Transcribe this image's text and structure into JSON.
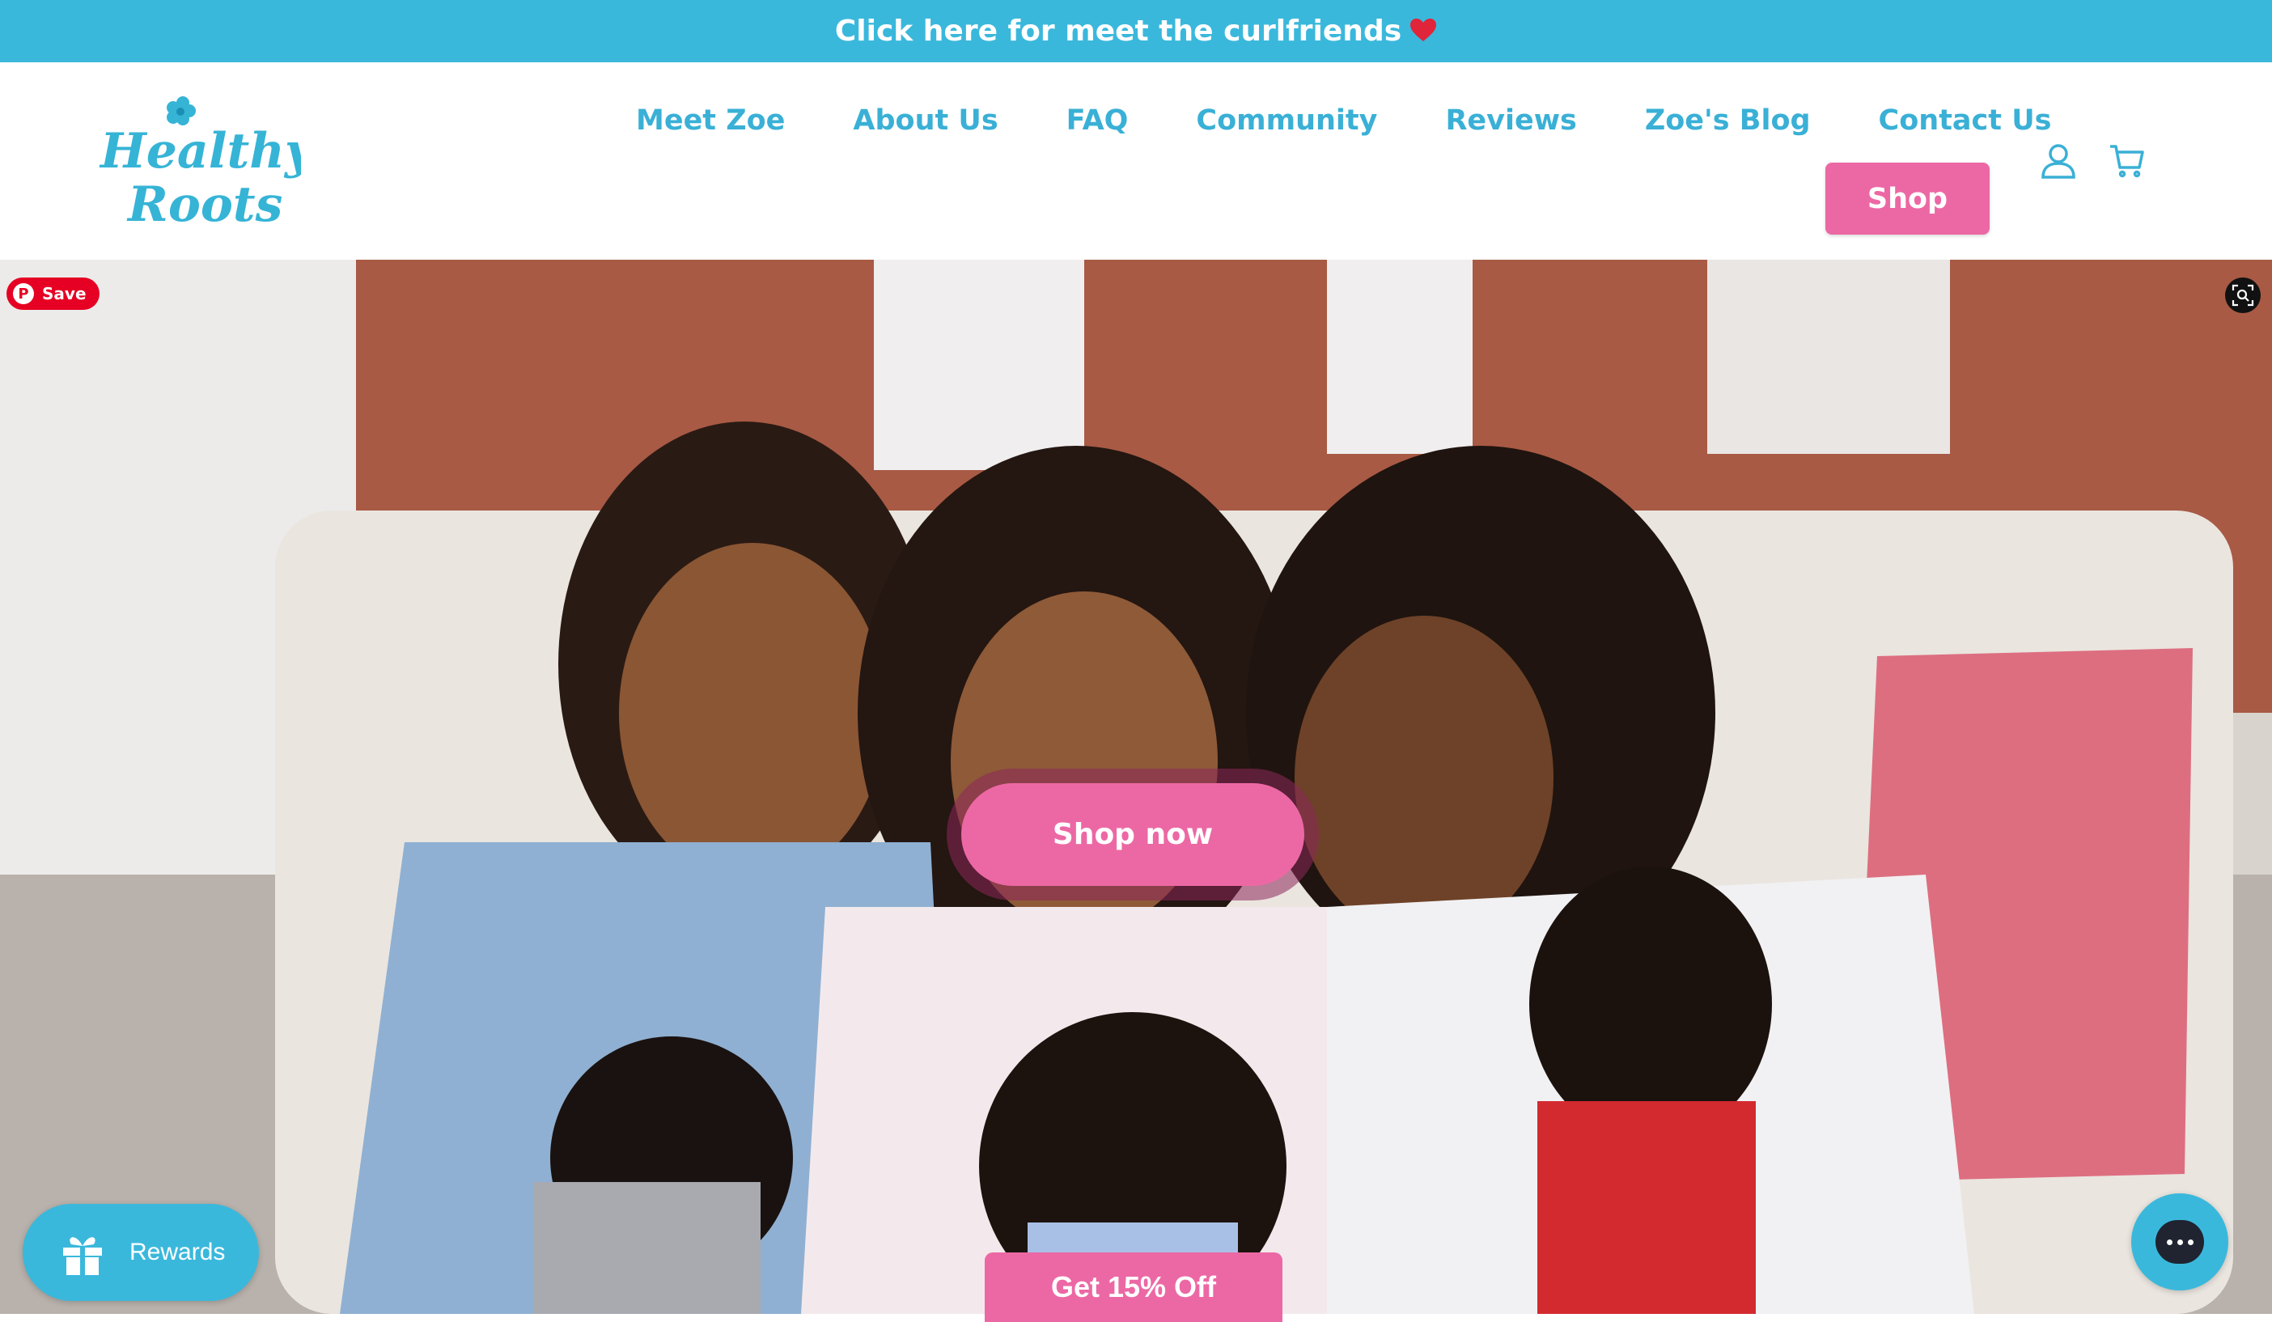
{
  "colors": {
    "brand_blue": "#3ab8dc",
    "nav_blue": "#3ab0d6",
    "brand_pink": "#ec68a4",
    "heart_red": "#e0243a"
  },
  "announcement": {
    "text": "Click here for meet the curlfriends",
    "icon": "heart-icon"
  },
  "logo": {
    "line1": "Healthy",
    "line2": "Roots",
    "icon": "flower-icon"
  },
  "nav": {
    "items": [
      "Meet Zoe",
      "About Us",
      "FAQ",
      "Community",
      "Reviews",
      "Zoe's Blog",
      "Contact Us"
    ],
    "shop_label": "Shop"
  },
  "header_icons": [
    "account-icon",
    "cart-icon"
  ],
  "hero": {
    "cta_label": "Shop now",
    "pinterest_save": "Save",
    "lens_icon": "visual-search-icon"
  },
  "discount": {
    "label": "Get 15% Off"
  },
  "rewards": {
    "label": "Rewards",
    "icon": "gift-icon"
  },
  "chat": {
    "icon": "chat-bubble-icon"
  }
}
